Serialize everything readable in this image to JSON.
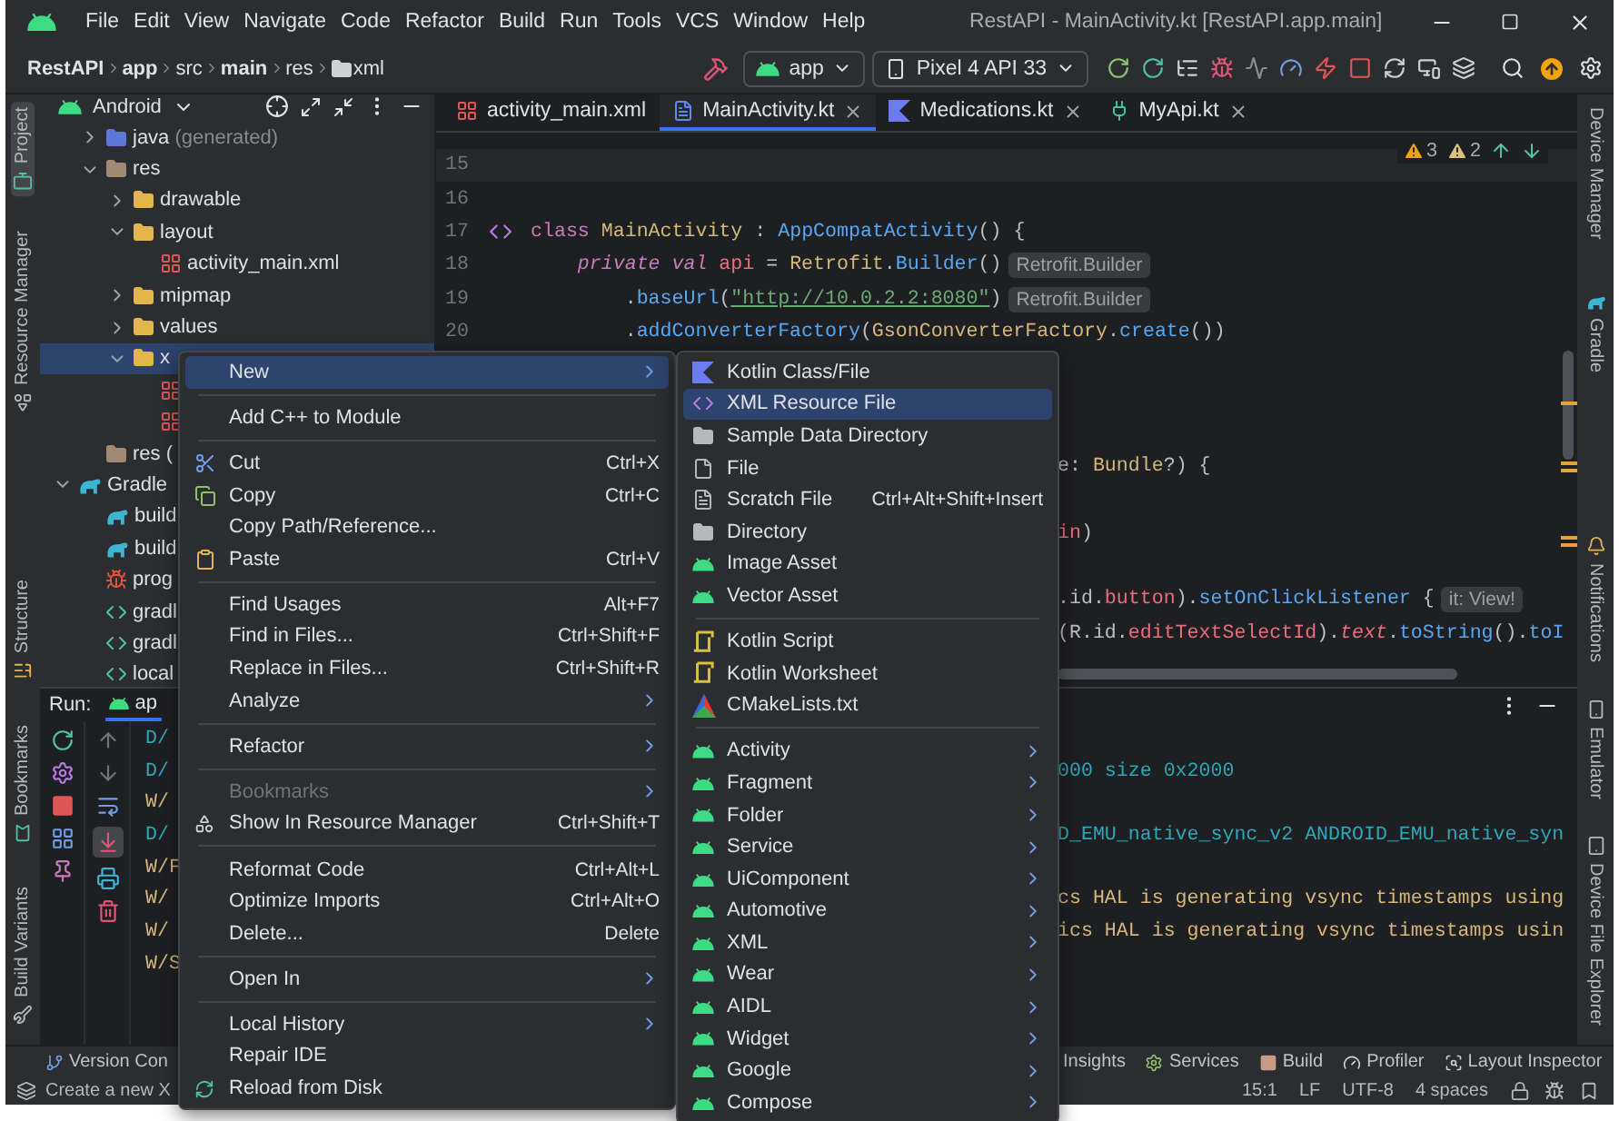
{
  "window": {
    "title": "RestAPI - MainActivity.kt [RestAPI.app.main]"
  },
  "menu_bar": [
    "File",
    "Edit",
    "View",
    "Navigate",
    "Code",
    "Refactor",
    "Build",
    "Run",
    "Tools",
    "VCS",
    "Window",
    "Help"
  ],
  "breadcrumbs": [
    {
      "label": "RestAPI",
      "kind": "module"
    },
    {
      "label": "app",
      "kind": "module"
    },
    {
      "label": "src",
      "kind": "dir"
    },
    {
      "label": "main",
      "kind": "module"
    },
    {
      "label": "res",
      "kind": "dir"
    },
    {
      "label": "xml",
      "kind": "folder"
    }
  ],
  "run_config": {
    "module": "app",
    "device": "Pixel 4 API 33"
  },
  "left_tool_windows": [
    {
      "label": "Project",
      "kind": "project",
      "selected": true
    },
    {
      "label": "Resource Manager",
      "kind": "resources",
      "selected": false
    }
  ],
  "left_tool_windows_bottom": [
    {
      "label": "Structure",
      "kind": "structure",
      "selected": false
    },
    {
      "label": "Bookmarks",
      "kind": "bookmarks",
      "selected": false
    },
    {
      "label": "Build Variants",
      "kind": "variants",
      "selected": false
    }
  ],
  "right_tool_windows": [
    {
      "label": "Device Manager",
      "kind": "devices",
      "selected": false
    },
    {
      "label": "Gradle",
      "kind": "gradle",
      "selected": false
    }
  ],
  "right_tool_windows_bottom": [
    {
      "label": "Notifications",
      "kind": "notifications",
      "selected": false
    },
    {
      "label": "Emulator",
      "kind": "emulator",
      "selected": false
    },
    {
      "label": "Device File Explorer",
      "kind": "explorer",
      "selected": false
    }
  ],
  "project_panel": {
    "view": "Android",
    "tree": [
      {
        "kind": "hidden-root",
        "children": [
          {
            "label": "java",
            "note": "(generated)",
            "kind": "source-folder",
            "selected": false,
            "expanded": false
          },
          {
            "label": "res",
            "kind": "res-root",
            "selected": false,
            "expanded": true,
            "children": [
              {
                "label": "drawable",
                "kind": "folder",
                "selected": false,
                "expanded": false
              },
              {
                "label": "layout",
                "kind": "folder",
                "selected": false,
                "expanded": true,
                "children": [
                  {
                    "label": "activity_main.xml",
                    "kind": "layout-file",
                    "selected": false
                  }
                ]
              },
              {
                "label": "mipmap",
                "kind": "folder",
                "selected": false,
                "expanded": false
              },
              {
                "label": "values",
                "kind": "folder",
                "selected": false,
                "expanded": false
              },
              {
                "label": "x",
                "kind": "folder",
                "selected": true,
                "expanded": true,
                "children": [
                  {
                    "kind": "layout-file",
                    "selected": false
                  },
                  {
                    "kind": "layout-file",
                    "selected": false
                  }
                ]
              }
            ]
          },
          {
            "label": "res (",
            "kind": "res-root",
            "selected": false
          }
        ]
      },
      {
        "label": "Gradle",
        "kind": "gradle",
        "selected": false,
        "expanded": true,
        "children": [
          {
            "label": "build",
            "kind": "gradle",
            "selected": false
          },
          {
            "label": "build",
            "kind": "gradle",
            "selected": false
          },
          {
            "label": "prog",
            "kind": "proguard",
            "selected": false
          },
          {
            "label": "gradl",
            "kind": "properties",
            "selected": false
          },
          {
            "label": "gradl",
            "kind": "properties",
            "selected": false
          },
          {
            "label": "local",
            "kind": "properties",
            "selected": false
          }
        ]
      }
    ]
  },
  "editor_tabs": [
    {
      "label": "activity_main.xml",
      "kind": "layout-file",
      "selected": false,
      "closable": false
    },
    {
      "label": "MainActivity.kt",
      "kind": "kotlin-class",
      "selected": true,
      "closable": true
    },
    {
      "label": "Medications.kt",
      "kind": "kotlin-file",
      "selected": false,
      "closable": true
    },
    {
      "label": "MyApi.kt",
      "kind": "interface",
      "selected": false,
      "closable": true
    }
  ],
  "inspections": {
    "warnings": "3",
    "weak_warnings": "2"
  },
  "code_lines": [
    {
      "number": "15",
      "current": true,
      "gutter_icon": false
    },
    {
      "number": "16",
      "current": false,
      "gutter_icon": false
    },
    {
      "number": "17",
      "current": false,
      "gutter_icon": true,
      "tokens": [
        {
          "t": "class ",
          "kind": "keyword"
        },
        {
          "t": "MainActivity",
          "kind": "type"
        },
        {
          "t": " : ",
          "kind": "plain"
        },
        {
          "t": "AppCompatActivity",
          "kind": "call"
        },
        {
          "t": "() {",
          "kind": "plain"
        }
      ]
    },
    {
      "number": "18",
      "current": false,
      "gutter_icon": false,
      "tokens": [
        {
          "t": "    private val ",
          "kind": "modifier"
        },
        {
          "t": "api",
          "kind": "field"
        },
        {
          "t": " = ",
          "kind": "plain"
        },
        {
          "t": "Retrofit",
          "kind": "type"
        },
        {
          "t": ".",
          "kind": "plain"
        },
        {
          "t": "Builder",
          "kind": "call"
        },
        {
          "t": "()",
          "kind": "plain"
        }
      ],
      "hint": "Retrofit.Builder"
    },
    {
      "number": "19",
      "current": false,
      "gutter_icon": false,
      "tokens": [
        {
          "t": "        .",
          "kind": "plain"
        },
        {
          "t": "baseUrl",
          "kind": "call"
        },
        {
          "t": "(",
          "kind": "plain"
        },
        {
          "t": "\"http://10.0.2.2:8080\"",
          "kind": "string"
        },
        {
          "t": ")",
          "kind": "plain"
        }
      ],
      "hint": "Retrofit.Builder"
    },
    {
      "number": "20",
      "current": false,
      "gutter_icon": false,
      "tokens": [
        {
          "t": "        .",
          "kind": "plain"
        },
        {
          "t": "addConverterFactory",
          "kind": "call"
        },
        {
          "t": "(",
          "kind": "plain"
        },
        {
          "t": "GsonConverterFactory",
          "kind": "type"
        },
        {
          "t": ".",
          "kind": "plain"
        },
        {
          "t": "create",
          "kind": "call"
        },
        {
          "t": "())",
          "kind": "plain"
        }
      ]
    }
  ],
  "clipped_lines": [
    {
      "tokens": [
        {
          "t": "e: ",
          "kind": "plain"
        },
        {
          "t": "Bundle",
          "kind": "type"
        },
        {
          "t": "?) {",
          "kind": "plain"
        }
      ]
    },
    {
      "tokens": [
        {
          "t": "in",
          "kind": "field"
        },
        {
          "t": ")",
          "kind": "plain"
        }
      ]
    },
    {
      "tokens": [
        {
          "t": ".id.",
          "kind": "plain"
        },
        {
          "t": "button",
          "kind": "field"
        },
        {
          "t": ").",
          "kind": "plain"
        },
        {
          "t": "setOnClickListener",
          "kind": "call"
        },
        {
          "t": " {",
          "kind": "plain"
        }
      ],
      "hint": "it: View!"
    },
    {
      "tokens": [
        {
          "t": "(R.id.",
          "kind": "plain"
        },
        {
          "t": "editTextSelectId",
          "kind": "field"
        },
        {
          "t": ").",
          "kind": "plain"
        },
        {
          "t": "text",
          "kind": "field-italic"
        },
        {
          "t": ".",
          "kind": "plain"
        },
        {
          "t": "toString",
          "kind": "call"
        },
        {
          "t": "().",
          "kind": "plain"
        },
        {
          "t": "toI",
          "kind": "call"
        }
      ]
    }
  ],
  "run_panel": {
    "label": "Run:",
    "tab": "ap",
    "logs": [
      {
        "kind": "debug",
        "text": "D/"
      },
      {
        "kind": "debug",
        "text": "D/",
        "tail": "000 size 0x2000"
      },
      {
        "kind": "warn",
        "text": "W/"
      },
      {
        "kind": "debug",
        "text": "D/",
        "tail": "D_EMU_native_sync_v2 ANDROID_EMU_native_syn"
      },
      {
        "kind": "warn",
        "text": "W/F"
      },
      {
        "kind": "warn",
        "text": "W/",
        "tail": "cs HAL is generating vsync timestamps using"
      },
      {
        "kind": "warn",
        "text": "W/",
        "tail": "ics HAL is generating vsync timestamps usin"
      },
      {
        "kind": "warn",
        "text": "W/S"
      }
    ]
  },
  "context_menu": {
    "groups": [
      {
        "items": [
          {
            "label": "New",
            "kind": "plain",
            "submenu": true,
            "selected": true,
            "disabled": false
          }
        ]
      },
      {
        "items": [
          {
            "label": "Add C++ to Module",
            "kind": "plain",
            "submenu": false,
            "selected": false,
            "disabled": false
          }
        ]
      },
      {
        "items": [
          {
            "label": "Cut",
            "kind": "cut",
            "shortcut": "Ctrl+X",
            "submenu": false,
            "selected": false,
            "disabled": false
          },
          {
            "label": "Copy",
            "kind": "copy",
            "shortcut": "Ctrl+C",
            "submenu": false,
            "selected": false,
            "disabled": false
          },
          {
            "label": "Copy Path/Reference...",
            "kind": "plain",
            "submenu": false,
            "selected": false,
            "disabled": false
          },
          {
            "label": "Paste",
            "kind": "paste",
            "shortcut": "Ctrl+V",
            "submenu": false,
            "selected": false,
            "disabled": false
          }
        ]
      },
      {
        "items": [
          {
            "label": "Find Usages",
            "kind": "plain",
            "shortcut": "Alt+F7",
            "submenu": false,
            "selected": false,
            "disabled": false
          },
          {
            "label": "Find in Files...",
            "kind": "plain",
            "shortcut": "Ctrl+Shift+F",
            "submenu": false,
            "selected": false,
            "disabled": false
          },
          {
            "label": "Replace in Files...",
            "kind": "plain",
            "shortcut": "Ctrl+Shift+R",
            "submenu": false,
            "selected": false,
            "disabled": false
          },
          {
            "label": "Analyze",
            "kind": "plain",
            "submenu": true,
            "selected": false,
            "disabled": false
          }
        ]
      },
      {
        "items": [
          {
            "label": "Refactor",
            "kind": "plain",
            "submenu": true,
            "selected": false,
            "disabled": false
          }
        ]
      },
      {
        "items": [
          {
            "label": "Bookmarks",
            "kind": "plain",
            "submenu": true,
            "selected": false,
            "disabled": true
          },
          {
            "label": "Show In Resource Manager",
            "kind": "resources",
            "shortcut": "Ctrl+Shift+T",
            "submenu": false,
            "selected": false,
            "disabled": false
          }
        ]
      },
      {
        "items": [
          {
            "label": "Reformat Code",
            "kind": "plain",
            "shortcut": "Ctrl+Alt+L",
            "submenu": false,
            "selected": false,
            "disabled": false
          },
          {
            "label": "Optimize Imports",
            "kind": "plain",
            "shortcut": "Ctrl+Alt+O",
            "submenu": false,
            "selected": false,
            "disabled": false
          },
          {
            "label": "Delete...",
            "kind": "plain",
            "shortcut": "Delete",
            "submenu": false,
            "selected": false,
            "disabled": false
          }
        ]
      },
      {
        "items": [
          {
            "label": "Open In",
            "kind": "plain",
            "submenu": true,
            "selected": false,
            "disabled": false
          }
        ]
      },
      {
        "items": [
          {
            "label": "Local History",
            "kind": "plain",
            "submenu": true,
            "selected": false,
            "disabled": false
          },
          {
            "label": "Repair IDE",
            "kind": "plain",
            "submenu": false,
            "selected": false,
            "disabled": false
          },
          {
            "label": "Reload from Disk",
            "kind": "reload",
            "submenu": false,
            "selected": false,
            "disabled": false
          }
        ]
      }
    ]
  },
  "new_submenu": {
    "groups": [
      {
        "items": [
          {
            "label": "Kotlin Class/File",
            "kind": "kotlin",
            "submenu": false,
            "selected": false
          },
          {
            "label": "XML Resource File",
            "kind": "xml",
            "submenu": false,
            "selected": true
          },
          {
            "label": "Sample Data Directory",
            "kind": "folder",
            "submenu": false,
            "selected": false
          },
          {
            "label": "File",
            "kind": "file",
            "submenu": false,
            "selected": false
          },
          {
            "label": "Scratch File",
            "kind": "scratch",
            "shortcut": "Ctrl+Alt+Shift+Insert",
            "submenu": false,
            "selected": false
          },
          {
            "label": "Directory",
            "kind": "folder",
            "submenu": false,
            "selected": false
          },
          {
            "label": "Image Asset",
            "kind": "android",
            "submenu": false,
            "selected": false
          },
          {
            "label": "Vector Asset",
            "kind": "android",
            "submenu": false,
            "selected": false
          }
        ]
      },
      {
        "items": [
          {
            "label": "Kotlin Script",
            "kind": "script",
            "submenu": false,
            "selected": false
          },
          {
            "label": "Kotlin Worksheet",
            "kind": "script",
            "submenu": false,
            "selected": false
          },
          {
            "label": "CMakeLists.txt",
            "kind": "cmake",
            "submenu": false,
            "selected": false
          }
        ]
      },
      {
        "items": [
          {
            "label": "Activity",
            "kind": "android",
            "submenu": true,
            "selected": false
          },
          {
            "label": "Fragment",
            "kind": "android",
            "submenu": true,
            "selected": false
          },
          {
            "label": "Folder",
            "kind": "android",
            "submenu": true,
            "selected": false
          },
          {
            "label": "Service",
            "kind": "android",
            "submenu": true,
            "selected": false
          },
          {
            "label": "UiComponent",
            "kind": "android",
            "submenu": true,
            "selected": false
          },
          {
            "label": "Automotive",
            "kind": "android",
            "submenu": true,
            "selected": false
          },
          {
            "label": "XML",
            "kind": "android",
            "submenu": true,
            "selected": false
          },
          {
            "label": "Wear",
            "kind": "android",
            "submenu": true,
            "selected": false
          },
          {
            "label": "AIDL",
            "kind": "android",
            "submenu": true,
            "selected": false
          },
          {
            "label": "Widget",
            "kind": "android",
            "submenu": true,
            "selected": false
          },
          {
            "label": "Google",
            "kind": "android",
            "submenu": true,
            "selected": false
          },
          {
            "label": "Compose",
            "kind": "android",
            "submenu": true,
            "selected": false
          }
        ]
      }
    ]
  },
  "tool_tabs": [
    {
      "label": "Version Con",
      "kind": "vcs"
    }
  ],
  "tool_tabs_right": [
    {
      "label": "Insights",
      "kind": "insights"
    },
    {
      "label": "Services",
      "kind": "services"
    },
    {
      "label": "Build",
      "kind": "build"
    },
    {
      "label": "Profiler",
      "kind": "profiler"
    },
    {
      "label": "Layout Inspector",
      "kind": "inspector"
    }
  ],
  "status_bar": {
    "message": "Create a new X",
    "items": [
      "15:1",
      "LF",
      "UTF-8",
      "4 spaces"
    ]
  }
}
